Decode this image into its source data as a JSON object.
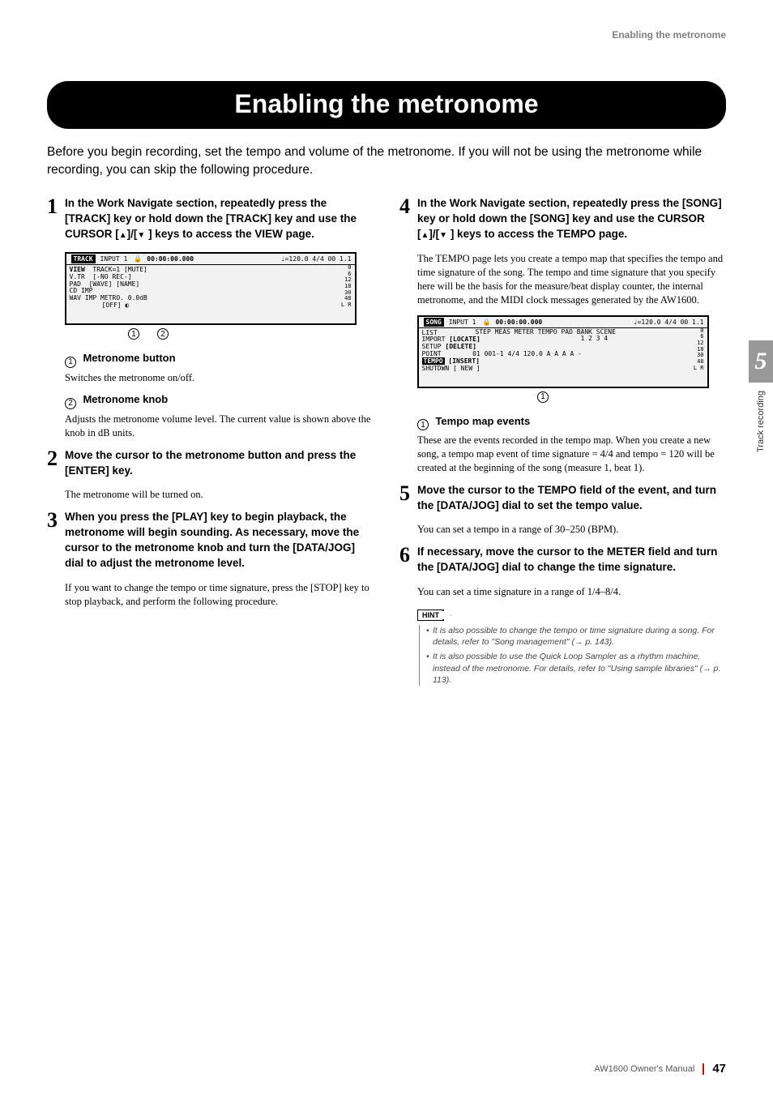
{
  "running_header": "Enabling the metronome",
  "title": "Enabling the metronome",
  "intro": "Before you begin recording, set the tempo and volume of the metronome. If you will not be using the metronome while recording, you can skip the following procedure.",
  "side_tab": {
    "num": "5",
    "text": "Track recording"
  },
  "left": {
    "step1": {
      "num": "1",
      "head_a": "In the Work Navigate section, repeatedly press the [TRACK] key or hold down the [TRACK] key and use the CURSOR [",
      "head_b": "]/[",
      "head_c": " ] keys to access the VIEW page."
    },
    "screenshot1": {
      "tab": "TRACK",
      "top_input": "INPUT 1",
      "top_time": "00:00:00.000",
      "top_meta": "♩=120.0 4/4 00 1.1",
      "rows": {
        "r1a": "VIEW",
        "r1b": "TRACK=1 [MUTE]",
        "r2a": "V.TR",
        "r2b": "[-NO REC-]",
        "r3a": "PAD",
        "r3b": "[WAVE] [NAME]",
        "r4a": "CD IMP",
        "r5a": "WAV IMP",
        "r5b": "METRO. 0.0dB",
        "r6": "[OFF]"
      },
      "meter": {
        "m1": "0",
        "m2": "6",
        "m3": "12",
        "m4": "18",
        "m5": "30",
        "m6": "48",
        "lr": "L R"
      }
    },
    "callouts1": [
      "1",
      "2"
    ],
    "sub1": {
      "num": "1",
      "label": "Metronome button",
      "body": "Switches the metronome on/off."
    },
    "sub2": {
      "num": "2",
      "label": "Metronome knob",
      "body": "Adjusts the metronome volume level. The current value is shown above the knob in dB units."
    },
    "step2": {
      "num": "2",
      "head": "Move the cursor to the metronome button and press the [ENTER] key.",
      "body": "The metronome will be turned on."
    },
    "step3": {
      "num": "3",
      "head": "When you press the [PLAY] key to begin playback, the metronome will begin sounding. As necessary, move the cursor to the metronome knob and turn the [DATA/JOG] dial to adjust the metronome level.",
      "body": "If you want to change the tempo or time signature, press the [STOP] key to stop playback, and perform the following procedure."
    }
  },
  "right": {
    "step4": {
      "num": "4",
      "head_a": "In the Work Navigate section, repeatedly press the [SONG] key or hold down the [SONG] key and use the CURSOR [",
      "head_b": "]/[",
      "head_c": " ] keys to access the TEMPO page.",
      "body": "The TEMPO page lets you create a tempo map that specifies the tempo and time signature of the song. The tempo and time signature that you specify here will be the basis for the measure/beat display counter, the internal metronome, and the MIDI clock messages generated by the AW1600."
    },
    "screenshot2": {
      "tab": "SONG",
      "top_input": "INPUT 1",
      "top_time": "00:00:00.000",
      "top_meta": "♩=120.0 4/4 00 1.1",
      "header_row": "STEP MEAS  METER TEMPO  PAD BANK SCENE",
      "header_nums": "1  2  3  4",
      "rows": {
        "r1a": "LIST",
        "r2a": "IMPORT",
        "r2b": "[LOCATE]",
        "r3a": "SETUP",
        "r3b": "[DELETE]",
        "r4a": "POINT",
        "r4b": "01 001-1 4/4 120.0  A  A  A  A  -",
        "r5a": "TEMPO",
        "r5b": "[INSERT]",
        "r6a": "SHUTDWN",
        "r6b": "[ NEW ]"
      },
      "meter": {
        "m1": "0",
        "m2": "6",
        "m3": "12",
        "m4": "18",
        "m5": "30",
        "m6": "48",
        "lr": "L R"
      }
    },
    "callouts2": [
      "1"
    ],
    "sub1": {
      "num": "1",
      "label": "Tempo map events",
      "body": "These are the events recorded in the tempo map. When you create a new song, a tempo map event of time signature = 4/4 and tempo = 120 will be created at the beginning of the song (measure 1, beat 1)."
    },
    "step5": {
      "num": "5",
      "head": "Move the cursor to the TEMPO field of the event, and turn the [DATA/JOG] dial to set the tempo value.",
      "body": "You can set a tempo in a range of 30–250 (BPM)."
    },
    "step6": {
      "num": "6",
      "head": "If necessary, move the cursor to the METER field and turn the [DATA/JOG] dial to change the time signature.",
      "body": "You can set a time signature in a range of 1/4–8/4."
    },
    "hint": {
      "tag": "HINT",
      "items": [
        "It is also possible to change the tempo or time signature during a song. For details, refer to \"Song management\" (→ p. 143).",
        "It is also possible to use the Quick Loop Sampler as a rhythm machine, instead of the metronome. For details, refer to \"Using sample libraries\" (→ p. 113)."
      ]
    }
  },
  "footer": {
    "manual": "AW1600  Owner's Manual",
    "page": "47"
  }
}
